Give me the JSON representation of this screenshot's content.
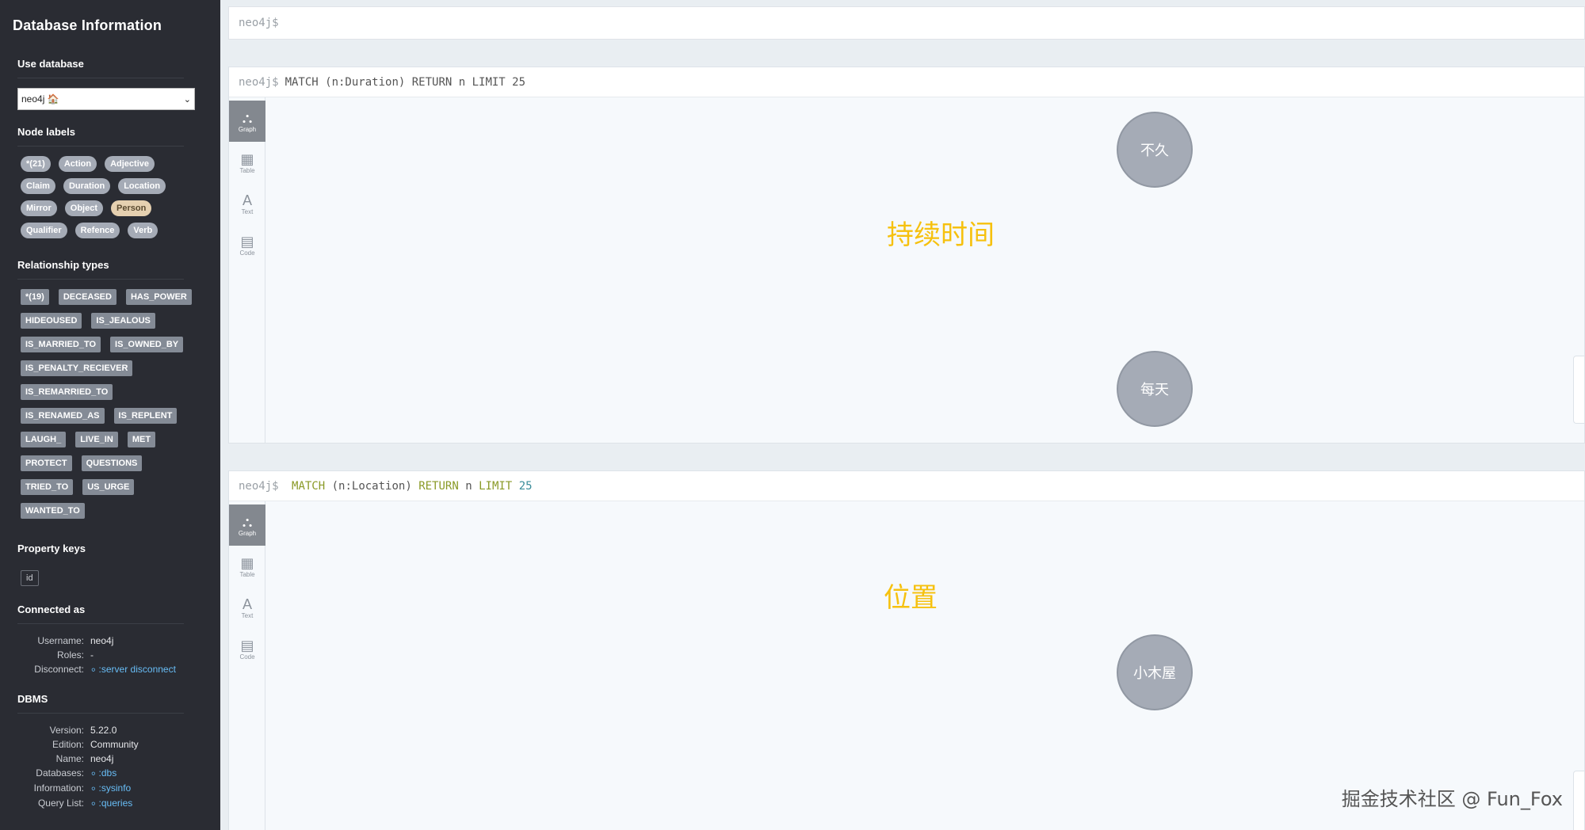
{
  "sidebar": {
    "title": "Database Information",
    "use_database": {
      "heading": "Use database",
      "selected": "neo4j 🏠"
    },
    "node_labels": {
      "heading": "Node labels",
      "items": [
        "*(21)",
        "Action",
        "Adjective",
        "Claim",
        "Duration",
        "Location",
        "Mirror",
        "Object",
        "Person",
        "Qualifier",
        "Refence",
        "Verb"
      ]
    },
    "relationship_types": {
      "heading": "Relationship types",
      "items": [
        "*(19)",
        "DECEASED",
        "HAS_POWER",
        "HIDEOUSED",
        "IS_JEALOUS",
        "IS_MARRIED_TO",
        "IS_OWNED_BY",
        "IS_PENALTY_RECIEVER",
        "IS_REMARRIED_TO",
        "IS_RENAMED_AS",
        "IS_REPLENT",
        "LAUGH_",
        "LIVE_IN",
        "MET",
        "PROTECT",
        "QUESTIONS",
        "TRIED_TO",
        "US_URGE",
        "WANTED_TO"
      ]
    },
    "property_keys": {
      "heading": "Property keys",
      "items": [
        "id"
      ]
    },
    "connected_as": {
      "heading": "Connected as",
      "rows": [
        {
          "k": "Username:",
          "v": "neo4j",
          "link": false
        },
        {
          "k": "Roles:",
          "v": "-",
          "link": false
        },
        {
          "k": "Disconnect:",
          "v": ":server disconnect",
          "link": true
        }
      ]
    },
    "dbms": {
      "heading": "DBMS",
      "rows": [
        {
          "k": "Version:",
          "v": "5.22.0",
          "link": false
        },
        {
          "k": "Edition:",
          "v": "Community",
          "link": false
        },
        {
          "k": "Name:",
          "v": "neo4j",
          "link": false
        },
        {
          "k": "Databases:",
          "v": ":dbs",
          "link": true
        },
        {
          "k": "Information:",
          "v": ":sysinfo",
          "link": true
        },
        {
          "k": "Query List:",
          "v": ":queries",
          "link": true
        }
      ]
    }
  },
  "editor": {
    "prompt": "neo4j$"
  },
  "tools": [
    {
      "icon": "⛬",
      "label": "Graph"
    },
    {
      "icon": "▦",
      "label": "Table"
    },
    {
      "icon": "A",
      "label": "Text"
    },
    {
      "icon": "▤",
      "label": "Code"
    }
  ],
  "frames": [
    {
      "prompt": "neo4j$",
      "query": "MATCH (n:Duration) RETURN n LIMIT 25",
      "overlay": "持续时间",
      "nodes": [
        "不久",
        "每天"
      ]
    },
    {
      "prompt": "neo4j$",
      "query_parts": {
        "kw1": "MATCH",
        "pattern": "(n:Location)",
        "kw2": "RETURN",
        "var": "n",
        "kw3": "LIMIT",
        "limit": "25"
      },
      "overlay": "位置",
      "nodes": [
        "小木屋"
      ]
    }
  ],
  "watermark": "掘金技术社区 @ Fun_Fox"
}
